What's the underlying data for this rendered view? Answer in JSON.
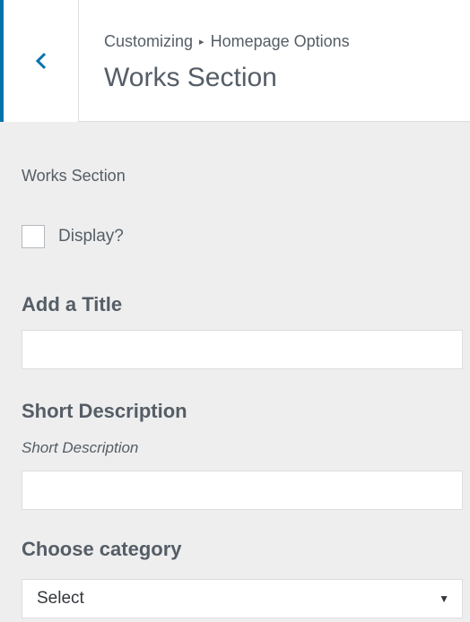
{
  "header": {
    "breadcrumb_root": "Customizing",
    "breadcrumb_separator": "▸",
    "breadcrumb_parent": "Homepage Options",
    "title": "Works Section"
  },
  "section": {
    "label": "Works Section"
  },
  "display_checkbox": {
    "label": "Display?",
    "checked": false
  },
  "title_field": {
    "heading": "Add a Title",
    "value": ""
  },
  "description_field": {
    "heading": "Short Description",
    "description": "Short Description",
    "value": ""
  },
  "category_field": {
    "heading": "Choose category",
    "selected": "Select",
    "arrow": "▼"
  },
  "colors": {
    "accent": "#0073aa",
    "panel_background": "#eeeeee",
    "text": "#555d66"
  },
  "icons": {
    "back": "chevron-left-icon"
  }
}
